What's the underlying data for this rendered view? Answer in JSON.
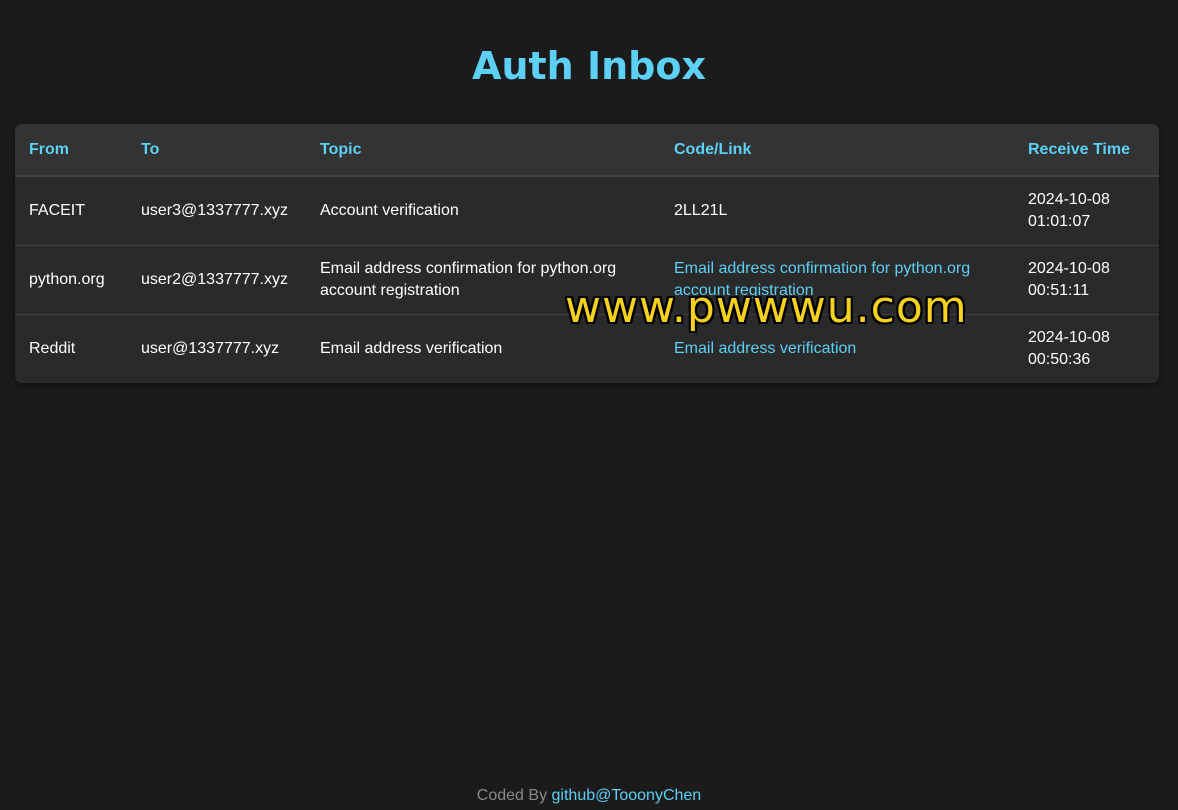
{
  "page": {
    "title": "Auth Inbox"
  },
  "table": {
    "headers": {
      "from": "From",
      "to": "To",
      "topic": "Topic",
      "code": "Code/Link",
      "time": "Receive Time"
    },
    "rows": [
      {
        "from": "FACEIT",
        "to": "user3@1337777.xyz",
        "topic": "Account verification",
        "code": "2LL21L",
        "code_is_link": false,
        "time_date": "2024-10-08",
        "time_clock": "01:01:07"
      },
      {
        "from": "python.org",
        "to": "user2@1337777.xyz",
        "topic": "Email address confirmation for python.org account registration",
        "code": "Email address confirmation for python.org account registration",
        "code_is_link": true,
        "time_date": "2024-10-08",
        "time_clock": "00:51:11"
      },
      {
        "from": "Reddit",
        "to": "user@1337777.xyz",
        "topic": "Email address verification",
        "code": "Email address verification",
        "code_is_link": true,
        "time_date": "2024-10-08",
        "time_clock": "00:50:36"
      }
    ]
  },
  "watermark": "www.pwwwu.com",
  "footer": {
    "prefix": "Coded By",
    "link_text": "github@TooonyChen"
  },
  "colors": {
    "background": "#1b1b1b",
    "accent": "#5cd0f5",
    "table_bg": "#2a2a2a",
    "watermark": "#f7d21c"
  }
}
